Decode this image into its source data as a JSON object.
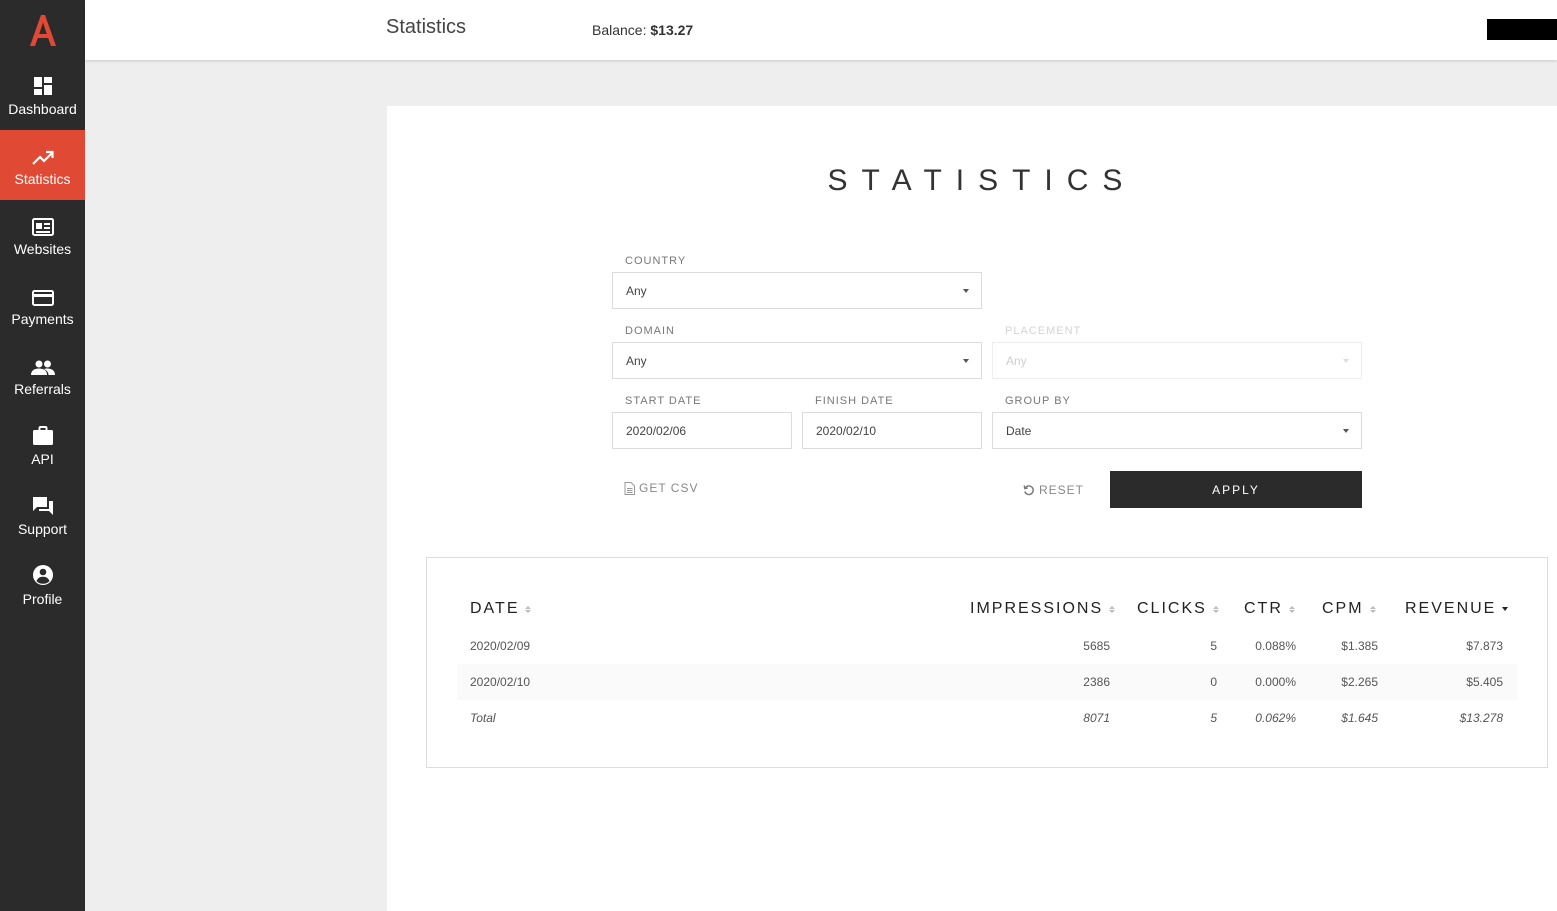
{
  "app": {
    "logo_letter": "A",
    "brand_color": "#e04a35"
  },
  "sidebar": {
    "items": [
      {
        "label": "Dashboard",
        "icon": "dashboard-icon",
        "active": false
      },
      {
        "label": "Statistics",
        "icon": "trending-up-icon",
        "active": true
      },
      {
        "label": "Websites",
        "icon": "websites-icon",
        "active": false
      },
      {
        "label": "Payments",
        "icon": "credit-card-icon",
        "active": false
      },
      {
        "label": "Referrals",
        "icon": "people-icon",
        "active": false
      },
      {
        "label": "API",
        "icon": "briefcase-icon",
        "active": false
      },
      {
        "label": "Support",
        "icon": "chat-icon",
        "active": false
      },
      {
        "label": "Profile",
        "icon": "account-circle-icon",
        "active": false
      }
    ]
  },
  "header": {
    "title": "Statistics",
    "balance_label": "Balance:",
    "balance_value": "$13.27"
  },
  "main": {
    "heading": "STATISTICS",
    "filters": {
      "country": {
        "label": "COUNTRY",
        "value": "Any"
      },
      "domain": {
        "label": "DOMAIN",
        "value": "Any"
      },
      "placement": {
        "label": "PLACEMENT",
        "value": "Any",
        "disabled": true
      },
      "start_date": {
        "label": "START DATE",
        "value": "2020/02/06"
      },
      "finish_date": {
        "label": "FINISH DATE",
        "value": "2020/02/10"
      },
      "group_by": {
        "label": "GROUP BY",
        "value": "Date"
      }
    },
    "actions": {
      "get_csv": "GET CSV",
      "reset": "RESET",
      "apply": "APPLY"
    },
    "table": {
      "columns": [
        "DATE",
        "IMPRESSIONS",
        "CLICKS",
        "CTR",
        "CPM",
        "REVENUE"
      ],
      "sorted_column": "REVENUE",
      "rows": [
        [
          "2020/02/09",
          "5685",
          "5",
          "0.088%",
          "$1.385",
          "$7.873"
        ],
        [
          "2020/02/10",
          "2386",
          "0",
          "0.000%",
          "$2.265",
          "$5.405"
        ]
      ],
      "total": [
        "Total",
        "8071",
        "5",
        "0.062%",
        "$1.645",
        "$13.278"
      ]
    }
  }
}
